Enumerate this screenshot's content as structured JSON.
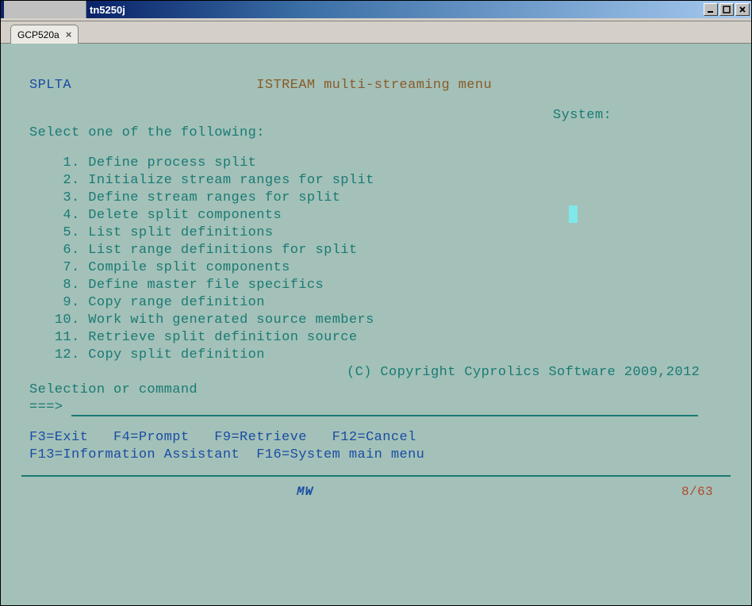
{
  "window": {
    "title": "tn5250j"
  },
  "tab": {
    "label": "GCP520a",
    "close": "×"
  },
  "screen": {
    "program": "SPLTA",
    "title": "ISTREAM multi-streaming menu",
    "system_label": "System:",
    "prompt": "Select one of the following:",
    "menu": [
      {
        "n": " 1",
        "text": "Define process split"
      },
      {
        "n": " 2",
        "text": "Initialize stream ranges for split"
      },
      {
        "n": " 3",
        "text": "Define stream ranges for split"
      },
      {
        "n": " 4",
        "text": "Delete split components"
      },
      {
        "n": " 5",
        "text": "List split definitions"
      },
      {
        "n": " 6",
        "text": "List range definitions for split"
      },
      {
        "n": " 7",
        "text": "Compile split components"
      },
      {
        "n": " 8",
        "text": "Define master file specifics"
      },
      {
        "n": " 9",
        "text": "Copy range definition"
      },
      {
        "n": "10",
        "text": "Work with generated source members"
      },
      {
        "n": "11",
        "text": "Retrieve split definition source"
      },
      {
        "n": "12",
        "text": "Copy split definition"
      }
    ],
    "copyright": "(C) Copyright Cyprolics Software 2009,2012",
    "selection_label": "Selection or command",
    "selection_arrow": "===>",
    "fkeys_line1": "F3=Exit   F4=Prompt   F9=Retrieve   F12=Cancel",
    "fkeys_line2": "F13=Information Assistant  F16=System main menu"
  },
  "status": {
    "mode": "MW",
    "position": "8/63"
  }
}
